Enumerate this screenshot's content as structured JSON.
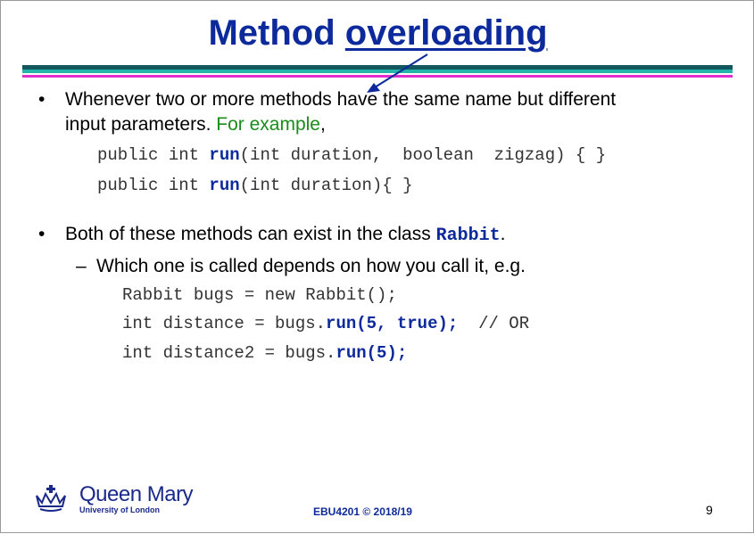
{
  "title": {
    "prefix": "Method ",
    "underlined": "overloading"
  },
  "colors": {
    "title": "#0c2a9b",
    "green": "#1a8c1a",
    "bar_dark": "#13585f",
    "bar_teal": "#22b5a8",
    "bar_magenta": "#e12dcb"
  },
  "bullet1": {
    "line1": "Whenever two or more methods have the same name but different",
    "line2_text": "input parameters. ",
    "line2_green": "For example",
    "line2_end": ","
  },
  "code1": [
    {
      "pre": "public int ",
      "kw": "run",
      "post": "(int duration,  boolean  zigzag) { }"
    },
    {
      "pre": "public int ",
      "kw": "run",
      "post": "(int duration){ }"
    }
  ],
  "bullet2": {
    "text": "Both of these methods can exist in the class ",
    "class_name": "Rabbit",
    "end": "."
  },
  "sub_bullet": {
    "dash": "–",
    "text": "Which one is called depends on how you call it, e.g."
  },
  "code2": {
    "line1": "Rabbit bugs = new Rabbit();",
    "line2_pre": "int distance = bugs.",
    "line2_kw": "run(5, true);",
    "line2_post": "  // OR",
    "line3_pre": "int distance2 = bugs.",
    "line3_kw": "run(5);"
  },
  "footer": {
    "org_name": "Queen Mary",
    "org_sub": "University of London",
    "course": "EBU4201 © 2018/19",
    "page": "9"
  },
  "icons": {
    "logo": "crown-crest-icon",
    "bullet": "bullet-dot-icon"
  }
}
